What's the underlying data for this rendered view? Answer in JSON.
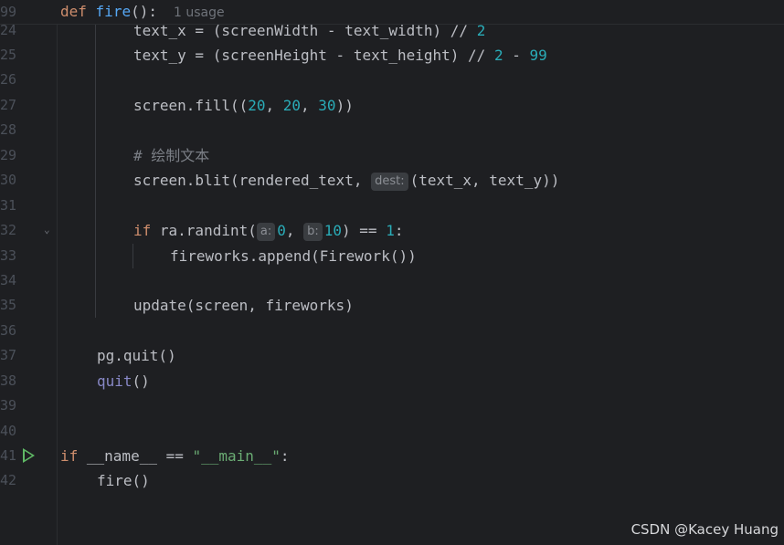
{
  "editor": {
    "sticky_header": {
      "line_number": "99",
      "keyword": "def",
      "function_name": "fire",
      "signature_rest": "():",
      "usage_hint": "1 usage"
    },
    "lines": [
      {
        "number": "24",
        "text_a": "text_x = (screenWidth - text_width) // ",
        "num_a": "2"
      },
      {
        "number": "25",
        "text_a": "text_y = (screenHeight - text_height) // ",
        "num_a": "2",
        "text_b": " - ",
        "num_b": "99"
      },
      {
        "number": "26"
      },
      {
        "number": "27",
        "text_a": "screen.fill((",
        "num_a": "20",
        "text_b": ", ",
        "num_b": "20",
        "text_c": ", ",
        "num_c": "30",
        "text_d": "))"
      },
      {
        "number": "28"
      },
      {
        "number": "29",
        "comment": "# 绘制文本"
      },
      {
        "number": "30",
        "text_a": "screen.blit(rendered_text, ",
        "hint": "dest:",
        "text_b": "(text_x, text_y))"
      },
      {
        "number": "31"
      },
      {
        "number": "32",
        "keyword": "if",
        "text_a": " ra.randint(",
        "hint_a": "a:",
        "num_a": "0",
        "text_b": ", ",
        "hint_b": "b:",
        "num_b": "10",
        "text_c": ") == ",
        "num_c": "1",
        "text_d": ":"
      },
      {
        "number": "33",
        "text_a": "fireworks.append(Firework())"
      },
      {
        "number": "34"
      },
      {
        "number": "35",
        "text_a": "update(screen, fireworks)"
      },
      {
        "number": "36"
      },
      {
        "number": "37",
        "text_a": "pg.quit()"
      },
      {
        "number": "38",
        "builtin": "quit",
        "text_a": "()"
      },
      {
        "number": "39"
      },
      {
        "number": "40"
      },
      {
        "number": "41",
        "keyword": "if",
        "text_a": " __name__ == ",
        "string": "\"__main__\"",
        "text_b": ":"
      },
      {
        "number": "42",
        "text_a": "fire()"
      }
    ]
  },
  "icons": {
    "run_icon": "run-triangle-icon",
    "fold_icon": "chevron-down-icon"
  },
  "colors": {
    "background": "#1e1f22",
    "keyword": "#cf8e6d",
    "function": "#56a8f5",
    "number": "#2aacb8",
    "string": "#6aab73",
    "run_icon": "#5fb865"
  },
  "watermark": "CSDN @Kacey Huang"
}
